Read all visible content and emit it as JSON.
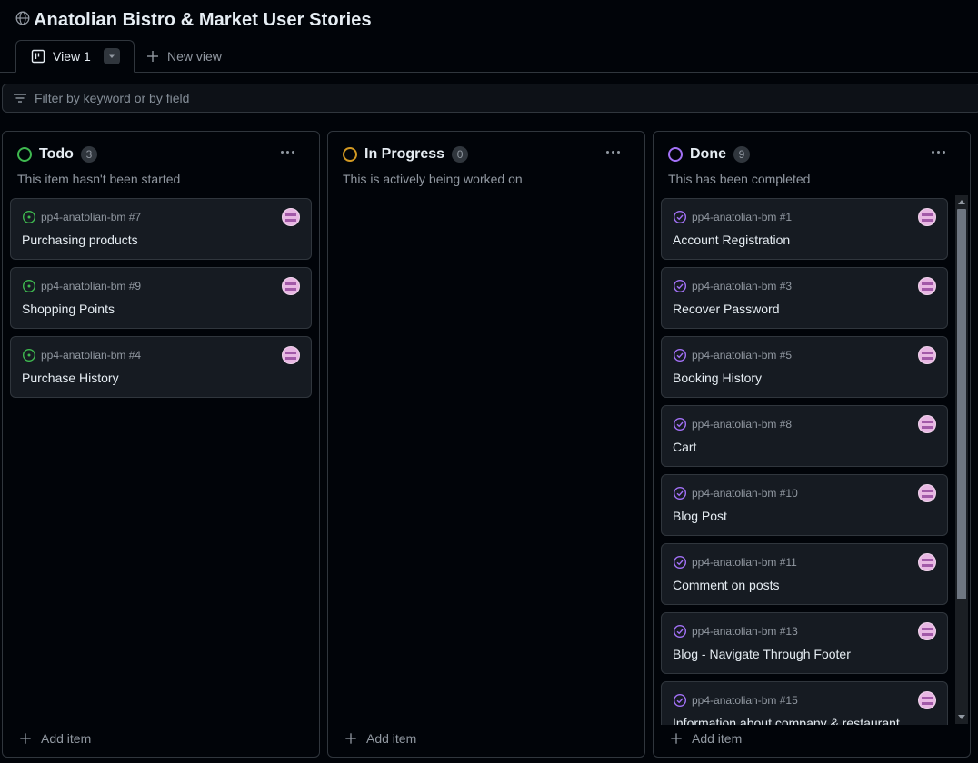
{
  "project": {
    "title": "Anatolian Bistro & Market User Stories"
  },
  "tabs": {
    "active_label": "View 1",
    "new_view_label": "New view"
  },
  "filter": {
    "placeholder": "Filter by keyword or by field"
  },
  "colors": {
    "todo": "#3fb950",
    "in_progress": "#d29922",
    "done": "#a371f7",
    "background": "#010409",
    "card": "#161b22",
    "border": "#30363d"
  },
  "columns": [
    {
      "name": "Todo",
      "count": "3",
      "description": "This item hasn't been started",
      "status_icon": "open-circle-icon",
      "add_label": "Add item",
      "cards": [
        {
          "ref": "pp4-anatolian-bm #7",
          "title": "Purchasing products"
        },
        {
          "ref": "pp4-anatolian-bm #9",
          "title": "Shopping Points"
        },
        {
          "ref": "pp4-anatolian-bm #4",
          "title": "Purchase History"
        }
      ]
    },
    {
      "name": "In Progress",
      "count": "0",
      "description": "This is actively being worked on",
      "status_icon": "open-circle-icon",
      "add_label": "Add item",
      "cards": []
    },
    {
      "name": "Done",
      "count": "9",
      "description": "This has been completed",
      "status_icon": "check-circle-icon",
      "add_label": "Add item",
      "cards": [
        {
          "ref": "pp4-anatolian-bm #1",
          "title": "Account Registration"
        },
        {
          "ref": "pp4-anatolian-bm #3",
          "title": "Recover Password"
        },
        {
          "ref": "pp4-anatolian-bm #5",
          "title": "Booking History"
        },
        {
          "ref": "pp4-anatolian-bm #8",
          "title": "Cart"
        },
        {
          "ref": "pp4-anatolian-bm #10",
          "title": "Blog Post"
        },
        {
          "ref": "pp4-anatolian-bm #11",
          "title": "Comment on posts"
        },
        {
          "ref": "pp4-anatolian-bm #13",
          "title": "Blog - Navigate Through Footer"
        },
        {
          "ref": "pp4-anatolian-bm #15",
          "title": "Information about company & restaurant"
        }
      ]
    }
  ]
}
